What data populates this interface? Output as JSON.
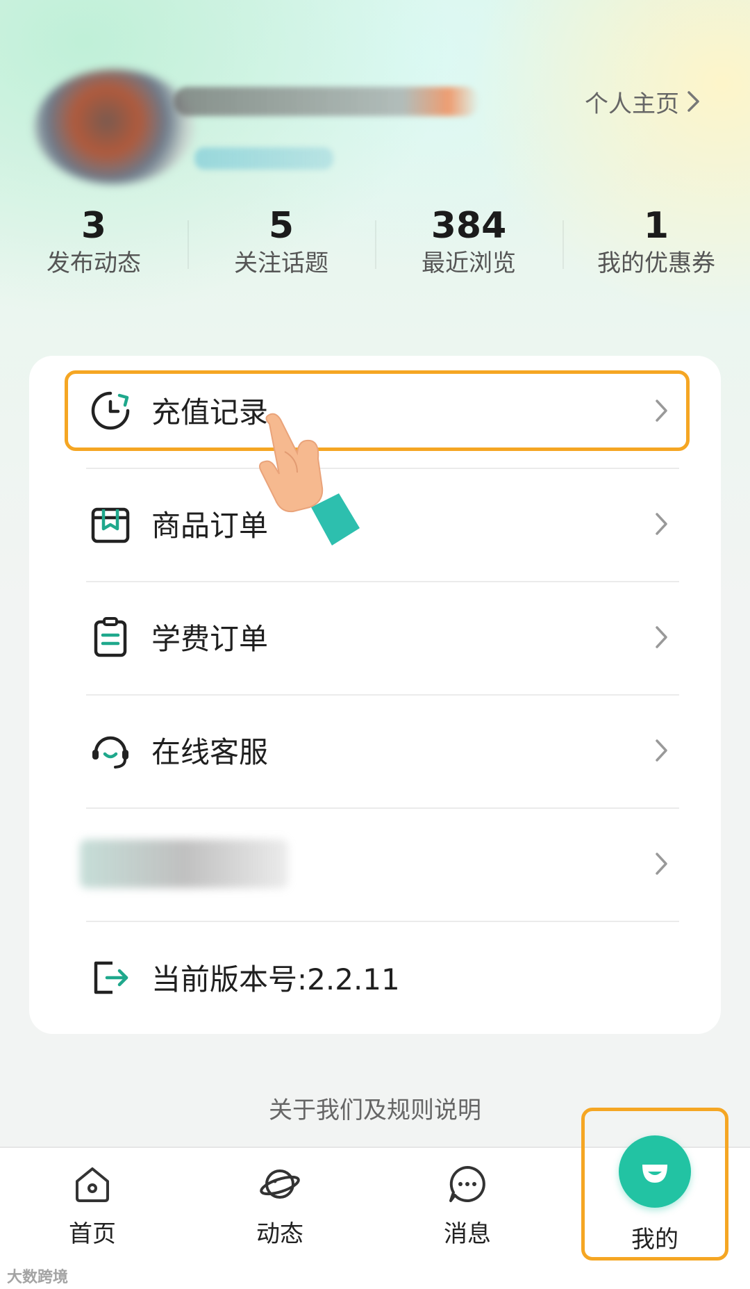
{
  "profile": {
    "homepage_link": "个人主页"
  },
  "stats": [
    {
      "value": "3",
      "label": "发布动态"
    },
    {
      "value": "5",
      "label": "关注话题"
    },
    {
      "value": "384",
      "label": "最近浏览"
    },
    {
      "value": "1",
      "label": "我的优惠券"
    }
  ],
  "menu": {
    "items": [
      {
        "label": "充值记录",
        "icon": "clock-history-icon"
      },
      {
        "label": "商品订单",
        "icon": "shopping-bag-icon"
      },
      {
        "label": "学费订单",
        "icon": "clipboard-list-icon"
      },
      {
        "label": "在线客服",
        "icon": "headset-icon"
      },
      {
        "label": "",
        "icon": "blurred-icon"
      }
    ],
    "version_label": "当前版本号:2.2.11"
  },
  "footer": {
    "about": "关于我们及规则说明"
  },
  "bottom_nav": {
    "items": [
      {
        "label": "首页",
        "icon": "home-icon"
      },
      {
        "label": "动态",
        "icon": "planet-icon"
      },
      {
        "label": "消息",
        "icon": "chat-bubble-icon"
      },
      {
        "label": "我的",
        "icon": "profile-smile-icon",
        "active": true
      }
    ]
  },
  "colors": {
    "accent": "#22c3a3",
    "highlight": "#f5a623",
    "icon_teal": "#1fa88c"
  },
  "watermark": "大数跨境"
}
